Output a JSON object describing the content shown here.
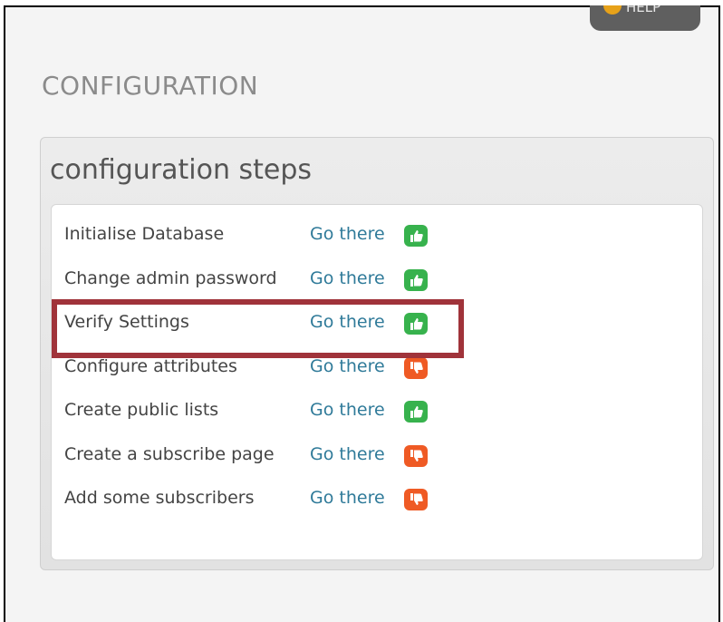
{
  "header": {
    "help_label": "HELP"
  },
  "page": {
    "title": "CONFIGURATION"
  },
  "panel": {
    "heading": "configuration steps",
    "steps": [
      {
        "label": "Initialise Database",
        "link": "Go there",
        "status": "thumbs-up"
      },
      {
        "label": "Change admin password",
        "link": "Go there",
        "status": "thumbs-up"
      },
      {
        "label": "Verify Settings",
        "link": "Go there",
        "status": "thumbs-up"
      },
      {
        "label": "Configure attributes",
        "link": "Go there",
        "status": "thumbs-down"
      },
      {
        "label": "Create public lists",
        "link": "Go there",
        "status": "thumbs-up"
      },
      {
        "label": "Create a subscribe page",
        "link": "Go there",
        "status": "thumbs-down"
      },
      {
        "label": "Add some subscribers",
        "link": "Go there",
        "status": "thumbs-down"
      }
    ]
  },
  "colors": {
    "thumbs_up": "#37b24d",
    "thumbs_down": "#ef5a24",
    "link": "#2f7a99",
    "highlight": "#a0333a"
  }
}
